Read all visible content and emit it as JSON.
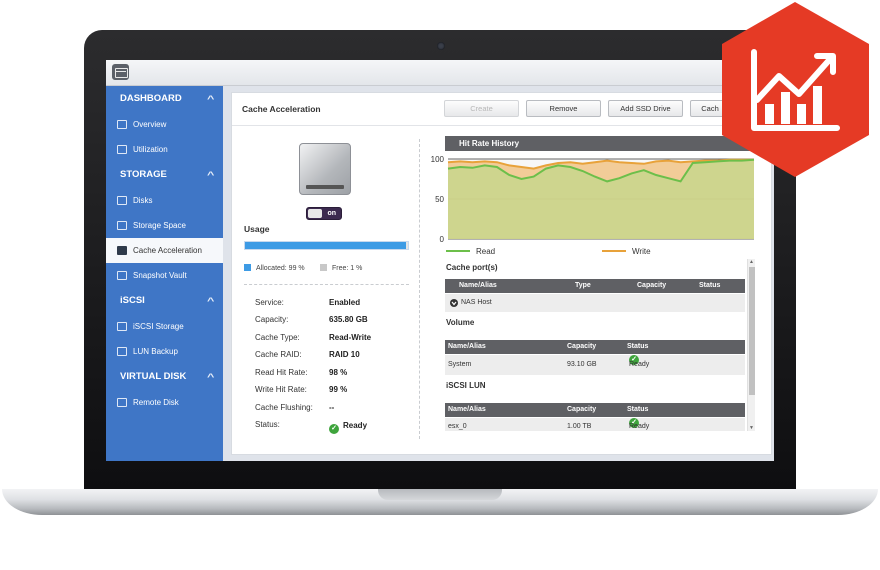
{
  "sidebar": {
    "sections": [
      {
        "title": "DASHBOARD",
        "items": [
          "Overview",
          "Utilization"
        ]
      },
      {
        "title": "STORAGE",
        "items": [
          "Disks",
          "Storage Space",
          "Cache Acceleration",
          "Snapshot Vault"
        ]
      },
      {
        "title": "iSCSI",
        "items": [
          "iSCSI Storage",
          "LUN Backup"
        ]
      },
      {
        "title": "VIRTUAL DISK",
        "items": [
          "Remote Disk"
        ]
      }
    ],
    "active_item": "Cache Acceleration"
  },
  "panel": {
    "title": "Cache Acceleration",
    "buttons": {
      "create": "Create",
      "remove": "Remove",
      "add_ssd": "Add SSD Drive",
      "cache": "Cach"
    },
    "toggle_label": "on",
    "usage_label": "Usage",
    "usage_allocated_percent": 99,
    "legend": {
      "allocated": "Allocated: 99 %",
      "free": "Free: 1 %"
    },
    "details": [
      {
        "label": "Service:",
        "value": "Enabled"
      },
      {
        "label": "Capacity:",
        "value": "635.80 GB"
      },
      {
        "label": "Cache Type:",
        "value": "Read-Write"
      },
      {
        "label": "Cache RAID:",
        "value": "RAID 10"
      },
      {
        "label": "Read Hit Rate:",
        "value": "98 %"
      },
      {
        "label": "Write Hit Rate:",
        "value": "99 %"
      },
      {
        "label": "Cache Flushing:",
        "value": "--"
      },
      {
        "label": "Status:",
        "value": "Ready"
      }
    ]
  },
  "chart_data": {
    "type": "area",
    "title": "Hit Rate History",
    "ylim": [
      0,
      100
    ],
    "yticks": [
      0,
      50,
      100
    ],
    "series": [
      {
        "name": "Read",
        "color": "#6cbf4a",
        "values": [
          88,
          90,
          89,
          92,
          90,
          80,
          75,
          78,
          88,
          92,
          90,
          85,
          78,
          72,
          76,
          82,
          86,
          80,
          76,
          72,
          95,
          96,
          97,
          98,
          98,
          99
        ]
      },
      {
        "name": "Write",
        "color": "#e8a23a",
        "values": [
          96,
          97,
          96,
          97,
          96,
          92,
          90,
          88,
          92,
          95,
          96,
          94,
          96,
          98,
          96,
          95,
          94,
          97,
          98,
          96,
          97,
          98,
          98,
          99,
          99,
          99
        ]
      }
    ],
    "grid": true
  },
  "colors": {
    "accent": "#3f76c6",
    "usage_fill": "#3d9be5",
    "ready": "#3ea43c",
    "badge": "#e53a25"
  },
  "cache_ports": {
    "heading": "Cache port(s)",
    "columns": [
      "Name/Alias",
      "Type",
      "Capacity",
      "Status"
    ],
    "rows": [
      {
        "name": "NAS Host",
        "type": "",
        "capacity": "",
        "status": ""
      }
    ]
  },
  "volume": {
    "heading": "Volume",
    "columns": [
      "Name/Alias",
      "Capacity",
      "Status"
    ],
    "rows": [
      {
        "name": "System",
        "capacity": "93.10 GB",
        "status": "Ready"
      }
    ]
  },
  "iscsi_lun": {
    "heading": "iSCSI LUN",
    "columns": [
      "Name/Alias",
      "Capacity",
      "Status"
    ],
    "rows": [
      {
        "name": "esx_0",
        "capacity": "1.00 TB",
        "status": "Ready"
      }
    ]
  },
  "badge_icon": "chart-analytics-icon"
}
